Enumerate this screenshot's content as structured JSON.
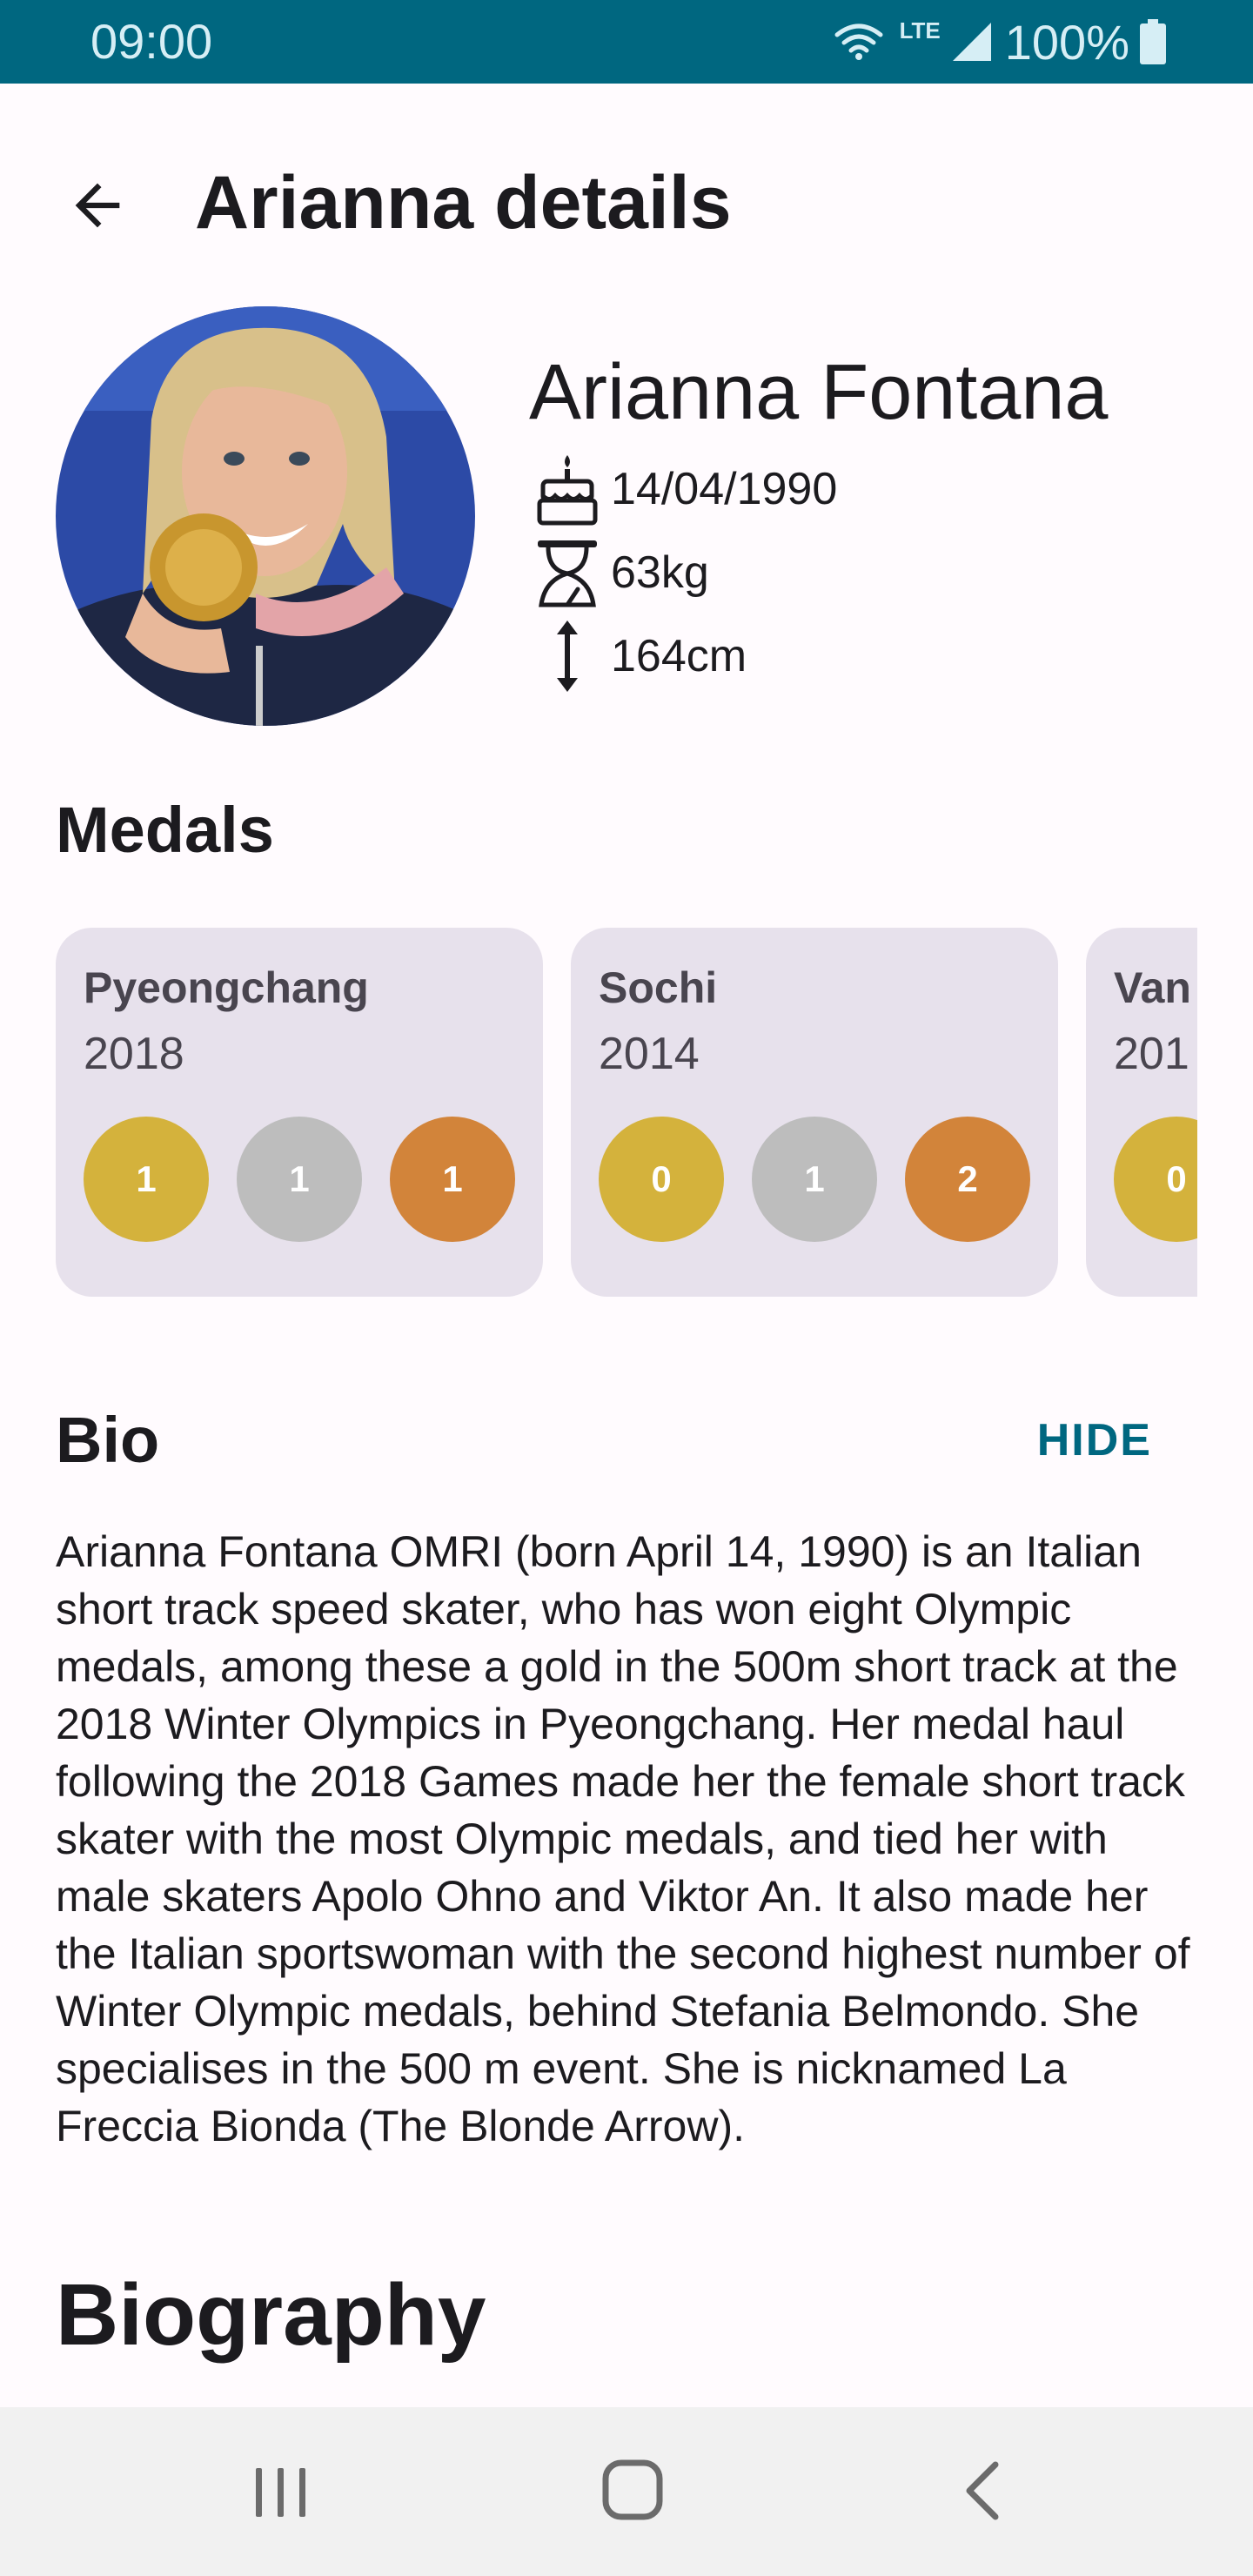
{
  "status_bar": {
    "time": "09:00",
    "network": "LTE",
    "battery": "100%",
    "icons": [
      "wifi-icon",
      "signal-icon",
      "battery-icon"
    ]
  },
  "app_bar": {
    "title": "Arianna details",
    "back_icon": "arrow-back-icon"
  },
  "athlete": {
    "name": "Arianna Fontana",
    "birth_date": "14/04/1990",
    "weight": "63kg",
    "height": "164cm",
    "icons": [
      "birthday-cake-icon",
      "weight-scale-icon",
      "height-arrow-icon"
    ]
  },
  "medals": {
    "heading": "Medals",
    "games": [
      {
        "name": "Pyeongchang",
        "year": "2018",
        "gold": "1",
        "silver": "1",
        "bronze": "1"
      },
      {
        "name": "Sochi",
        "year": "2014",
        "gold": "0",
        "silver": "1",
        "bronze": "2"
      },
      {
        "name": "Van",
        "year": "201",
        "gold": "0",
        "silver": "",
        "bronze": ""
      }
    ],
    "colors": {
      "gold": "#d4b23c",
      "silver": "#bdbdbd",
      "bronze": "#d2843a",
      "card": "#e7e1ec"
    }
  },
  "bio": {
    "heading": "Bio",
    "toggle_label": "HIDE",
    "text": "Arianna Fontana OMRI (born April 14, 1990) is an Italian short track speed skater, who has won eight Olympic medals, among these a gold in the 500m short track at the 2018 Winter Olympics in Pyeongchang. Her medal haul following the 2018 Games made her the female short track skater with the most Olympic medals, and tied her with male skaters Apolo Ohno and Viktor An. It also made her the Italian sportswoman with the second highest number of Winter Olympic medals, behind Stefania Belmondo. She specialises in the 500 m event. She is nicknamed La Freccia Bionda (The Blonde Arrow)."
  },
  "biography": {
    "heading": "Biography"
  },
  "theme": {
    "primary": "#006780",
    "background": "#fffbfe"
  },
  "nav_bar": {
    "icons": [
      "recent-apps-icon",
      "home-icon",
      "nav-back-icon"
    ]
  }
}
